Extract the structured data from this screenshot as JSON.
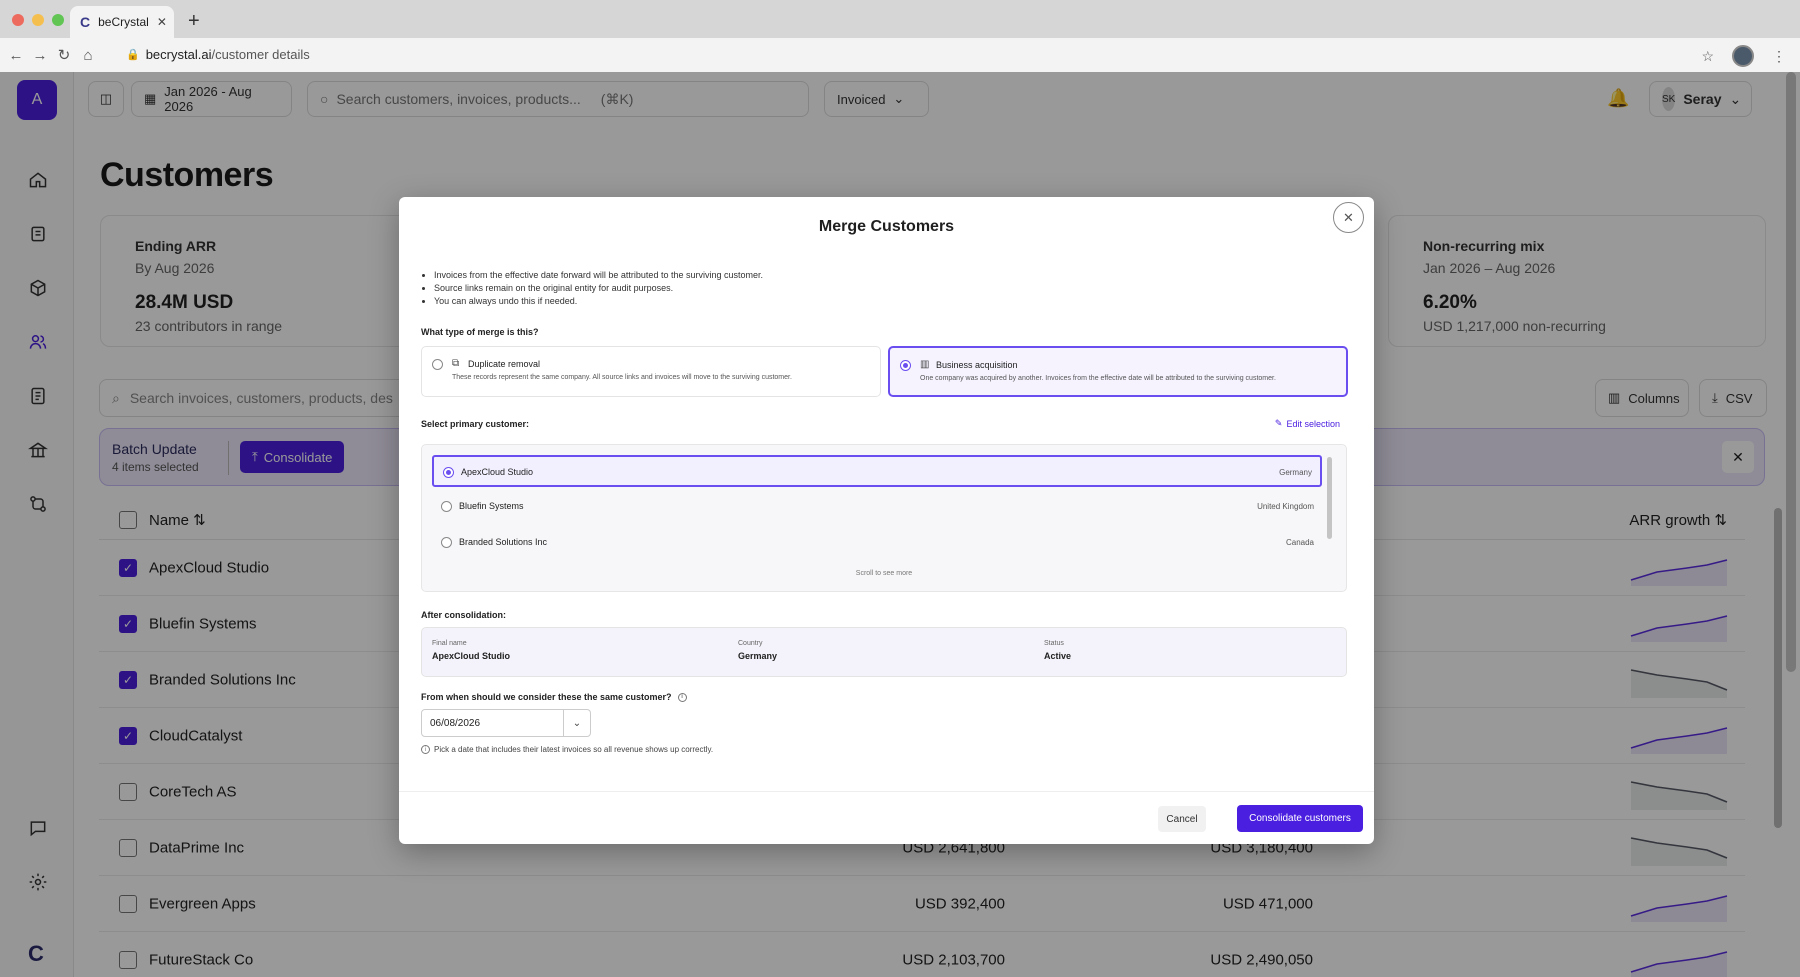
{
  "browser": {
    "tab_title": "beCrystal",
    "tab_favicon": "C",
    "url_domain": "becrystal.ai",
    "url_path": "/customer details"
  },
  "topbar": {
    "date_range": "Jan 2026 - Aug 2026",
    "search_placeholder": "Search customers, invoices, products...",
    "search_shortcut": "(⌘K)",
    "filter_label": "Invoiced",
    "user_initials": "SK",
    "user_name": "Seray"
  },
  "sidebar": {
    "workspace_initial": "A",
    "brand_initial": "C"
  },
  "page": {
    "title": "Customers"
  },
  "kpis": [
    {
      "title": "Ending ARR",
      "sub": "By Aug 2026",
      "value": "28.4M USD",
      "note": "23 contributors in range"
    },
    {
      "title": "Non-recurring mix",
      "sub": "Jan 2026 – Aug 2026",
      "value": "6.20%",
      "note": "USD 1,217,000 non-recurring"
    }
  ],
  "table_toolbar": {
    "search_placeholder": "Search invoices, customers, products, des",
    "columns_label": "Columns",
    "csv_label": "CSV"
  },
  "batch": {
    "title": "Batch Update",
    "subtitle": "4 items selected",
    "consolidate_label": "Consolidate"
  },
  "table": {
    "col_name": "Name",
    "col_growth": "ARR growth",
    "rows": [
      {
        "name": "ApexCloud Studio",
        "checked": true,
        "v1": "",
        "v2": "",
        "trend": "up"
      },
      {
        "name": "Bluefin Systems",
        "checked": true,
        "v1": "",
        "v2": "",
        "trend": "up"
      },
      {
        "name": "Branded Solutions Inc",
        "checked": true,
        "v1": "",
        "v2": "",
        "trend": "down"
      },
      {
        "name": "CloudCatalyst",
        "checked": true,
        "v1": "",
        "v2": "",
        "trend": "up"
      },
      {
        "name": "CoreTech AS",
        "checked": false,
        "v1": "",
        "v2": "",
        "trend": "down"
      },
      {
        "name": "DataPrime Inc",
        "checked": false,
        "v1": "USD 2,641,800",
        "v2": "USD 3,180,400",
        "trend": "down"
      },
      {
        "name": "Evergreen Apps",
        "checked": false,
        "v1": "USD 392,400",
        "v2": "USD 471,000",
        "trend": "up"
      },
      {
        "name": "FutureStack Co",
        "checked": false,
        "v1": "USD 2,103,700",
        "v2": "USD 2,490,050",
        "trend": "up"
      }
    ]
  },
  "modal": {
    "title": "Merge Customers",
    "bullets": [
      "Invoices from the effective date forward will be attributed to the surviving customer.",
      "Source links remain on the original entity for audit purposes.",
      "You can always undo this if needed."
    ],
    "merge_type_label": "What type of merge is this?",
    "options": [
      {
        "title": "Duplicate removal",
        "desc": "These records represent the same company. All source links and invoices will move to the surviving customer.",
        "selected": false
      },
      {
        "title": "Business acquisition",
        "desc": "One company was acquired by another. Invoices from the effective date will be attributed to the surviving customer.",
        "selected": true
      }
    ],
    "primary_label": "Select primary customer:",
    "edit_selection": "Edit selection",
    "customers": [
      {
        "name": "ApexCloud Studio",
        "country": "Germany",
        "selected": true
      },
      {
        "name": "Bluefin Systems",
        "country": "United Kingdom",
        "selected": false
      },
      {
        "name": "Branded Solutions Inc",
        "country": "Canada",
        "selected": false
      }
    ],
    "scroll_hint": "Scroll to see more",
    "after_label": "After consolidation:",
    "after": {
      "final_name_label": "Final name",
      "final_name": "ApexCloud Studio",
      "country_label": "Country",
      "country": "Germany",
      "status_label": "Status",
      "status": "Active"
    },
    "date_question": "From when should we consider these the same customer?",
    "date_value": "06/08/2026",
    "date_hint": "Pick a date that includes their latest invoices so all revenue shows up correctly.",
    "cancel_label": "Cancel",
    "confirm_label": "Consolidate customers"
  },
  "colors": {
    "accent": "#4b1fe0",
    "accent_light": "#6b4ef0",
    "spark_up": "#5b2ee0",
    "spark_down": "#555a66"
  }
}
